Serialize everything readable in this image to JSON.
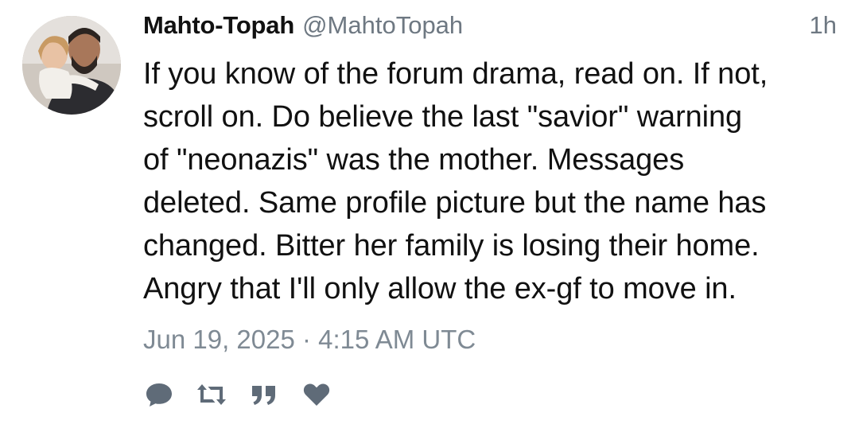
{
  "tweet": {
    "display_name": "Mahto-Topah",
    "handle": "@MahtoTopah",
    "time_ago": "1h",
    "text": "If you know of the forum drama, read on. If not,\nscroll on. Do believe the last \"savior\" warning\nof \"neonazis\" was the mother. Messages\ndeleted. Same profile picture but the name has\nchanged. Bitter her family is losing their home.\nAngry that I'll only allow the ex-gf to move in.",
    "timestamp": "Jun 19, 2025 · 4:15 AM UTC"
  },
  "actions": [
    {
      "icon": "comment-icon"
    },
    {
      "icon": "retweet-icon"
    },
    {
      "icon": "quote-icon"
    },
    {
      "icon": "heart-icon"
    }
  ],
  "colors": {
    "text": "#111111",
    "muted": "#6e7882",
    "icon": "#5f6b78"
  }
}
